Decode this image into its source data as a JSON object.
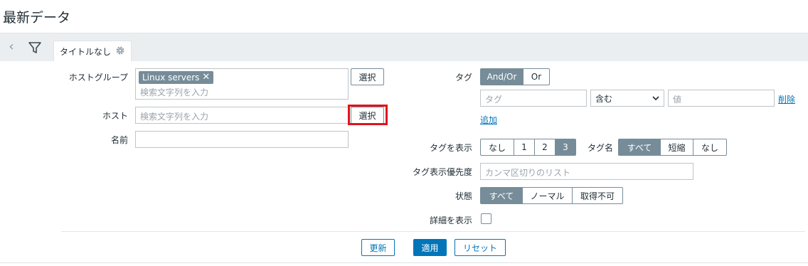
{
  "page": {
    "title": "最新データ"
  },
  "tabs": [
    {
      "label": "タイトルなし"
    }
  ],
  "filter": {
    "hostgroup_label": "ホストグループ",
    "hostgroup_chip": "Linux servers",
    "hostgroup_placeholder": "検索文字列を入力",
    "select_label": "選択",
    "host_label": "ホスト",
    "host_placeholder": "検索文字列を入力",
    "name_label": "名前",
    "name_value": "",
    "tags_label": "タグ",
    "tags_mode": [
      "And/Or",
      "Or"
    ],
    "tag_placeholder": "タグ",
    "tag_operator": "含む",
    "value_placeholder": "値",
    "remove_label": "削除",
    "add_label": "追加",
    "show_tags_label": "タグを表示",
    "show_tags_options": [
      "なし",
      "1",
      "2",
      "3"
    ],
    "tag_name_label": "タグ名",
    "tag_name_options": [
      "すべて",
      "短縮",
      "なし"
    ],
    "tag_priority_label": "タグ表示優先度",
    "tag_priority_placeholder": "カンマ区切りのリスト",
    "state_label": "状態",
    "state_options": [
      "すべて",
      "ノーマル",
      "取得不可"
    ],
    "show_details_label": "詳細を表示"
  },
  "actions": {
    "update": "更新",
    "apply": "適用",
    "reset": "リセット"
  },
  "colors": {
    "accent": "#0275b8",
    "segment_active": "#768d99",
    "highlight": "#e0131b"
  }
}
